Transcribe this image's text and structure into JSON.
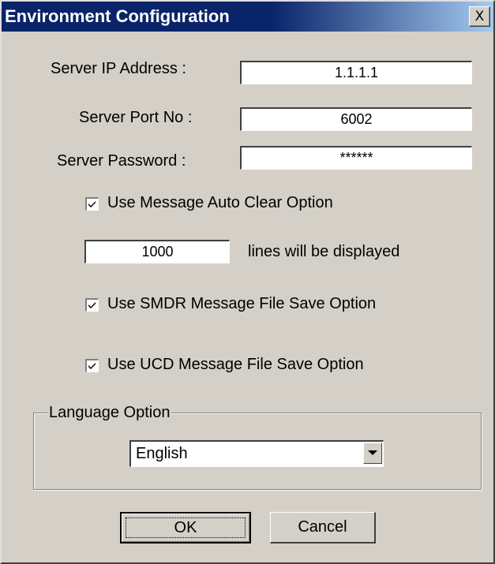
{
  "window": {
    "title": "Environment Configuration",
    "close_glyph": "X"
  },
  "server": {
    "ip_label": "Server IP Address :",
    "ip_value": "1.1.1.1",
    "port_label": "Server Port No :",
    "port_value": "6002",
    "password_label": "Server Password :",
    "password_value": "******"
  },
  "options": {
    "auto_clear": {
      "label": "Use Message Auto Clear Option",
      "checked": true
    },
    "lines_value": "1000",
    "lines_suffix": "lines will be displayed",
    "smdr_save": {
      "label": "Use SMDR Message File Save Option",
      "checked": true
    },
    "ucd_save": {
      "label": "Use UCD Message File Save Option",
      "checked": true
    }
  },
  "language": {
    "group_label": "Language Option",
    "selected": "English"
  },
  "buttons": {
    "ok": "OK",
    "cancel": "Cancel"
  },
  "colors": {
    "titlebar_start": "#0a246a",
    "titlebar_end": "#a6caf0",
    "dialog_face": "#d4d0c8"
  }
}
